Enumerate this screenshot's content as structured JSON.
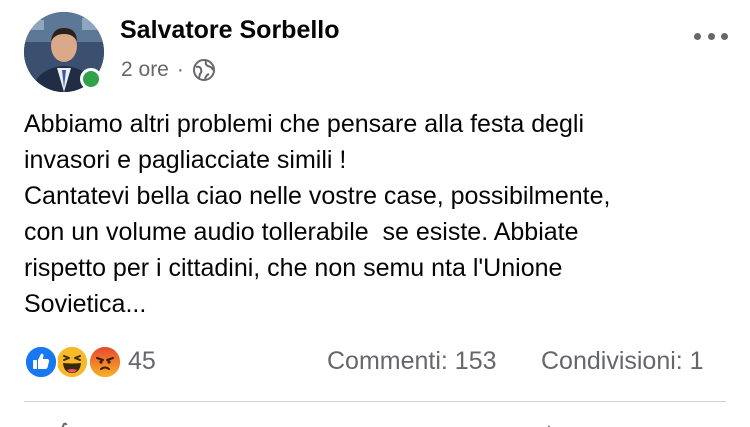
{
  "post": {
    "author": "Salvatore Sorbello",
    "time": "2 ore",
    "separator": "·",
    "audience_icon": "globe-icon",
    "text_lines": [
      "Abbiamo altri problemi che pensare alla festa degli",
      "invasori e pagliacciate simili !",
      "Cantatevi bella ciao nelle vostre case, possibilmente,",
      "con un volume audio tollerabile  se esiste. Abbiate",
      "rispetto per i cittadini, che non semu nta l'Unione",
      "Sovietica..."
    ]
  },
  "reactions": {
    "icons": [
      "like-icon",
      "haha-icon",
      "angry-icon"
    ],
    "count": "45"
  },
  "stats": {
    "comments": "Commenti: 153",
    "shares": "Condivisioni: 1"
  },
  "colors": {
    "online": "#31a24c",
    "like": "#1877f2",
    "haha": "#f7b928",
    "angry": "#e9710f",
    "secondary_text": "#65676b"
  }
}
